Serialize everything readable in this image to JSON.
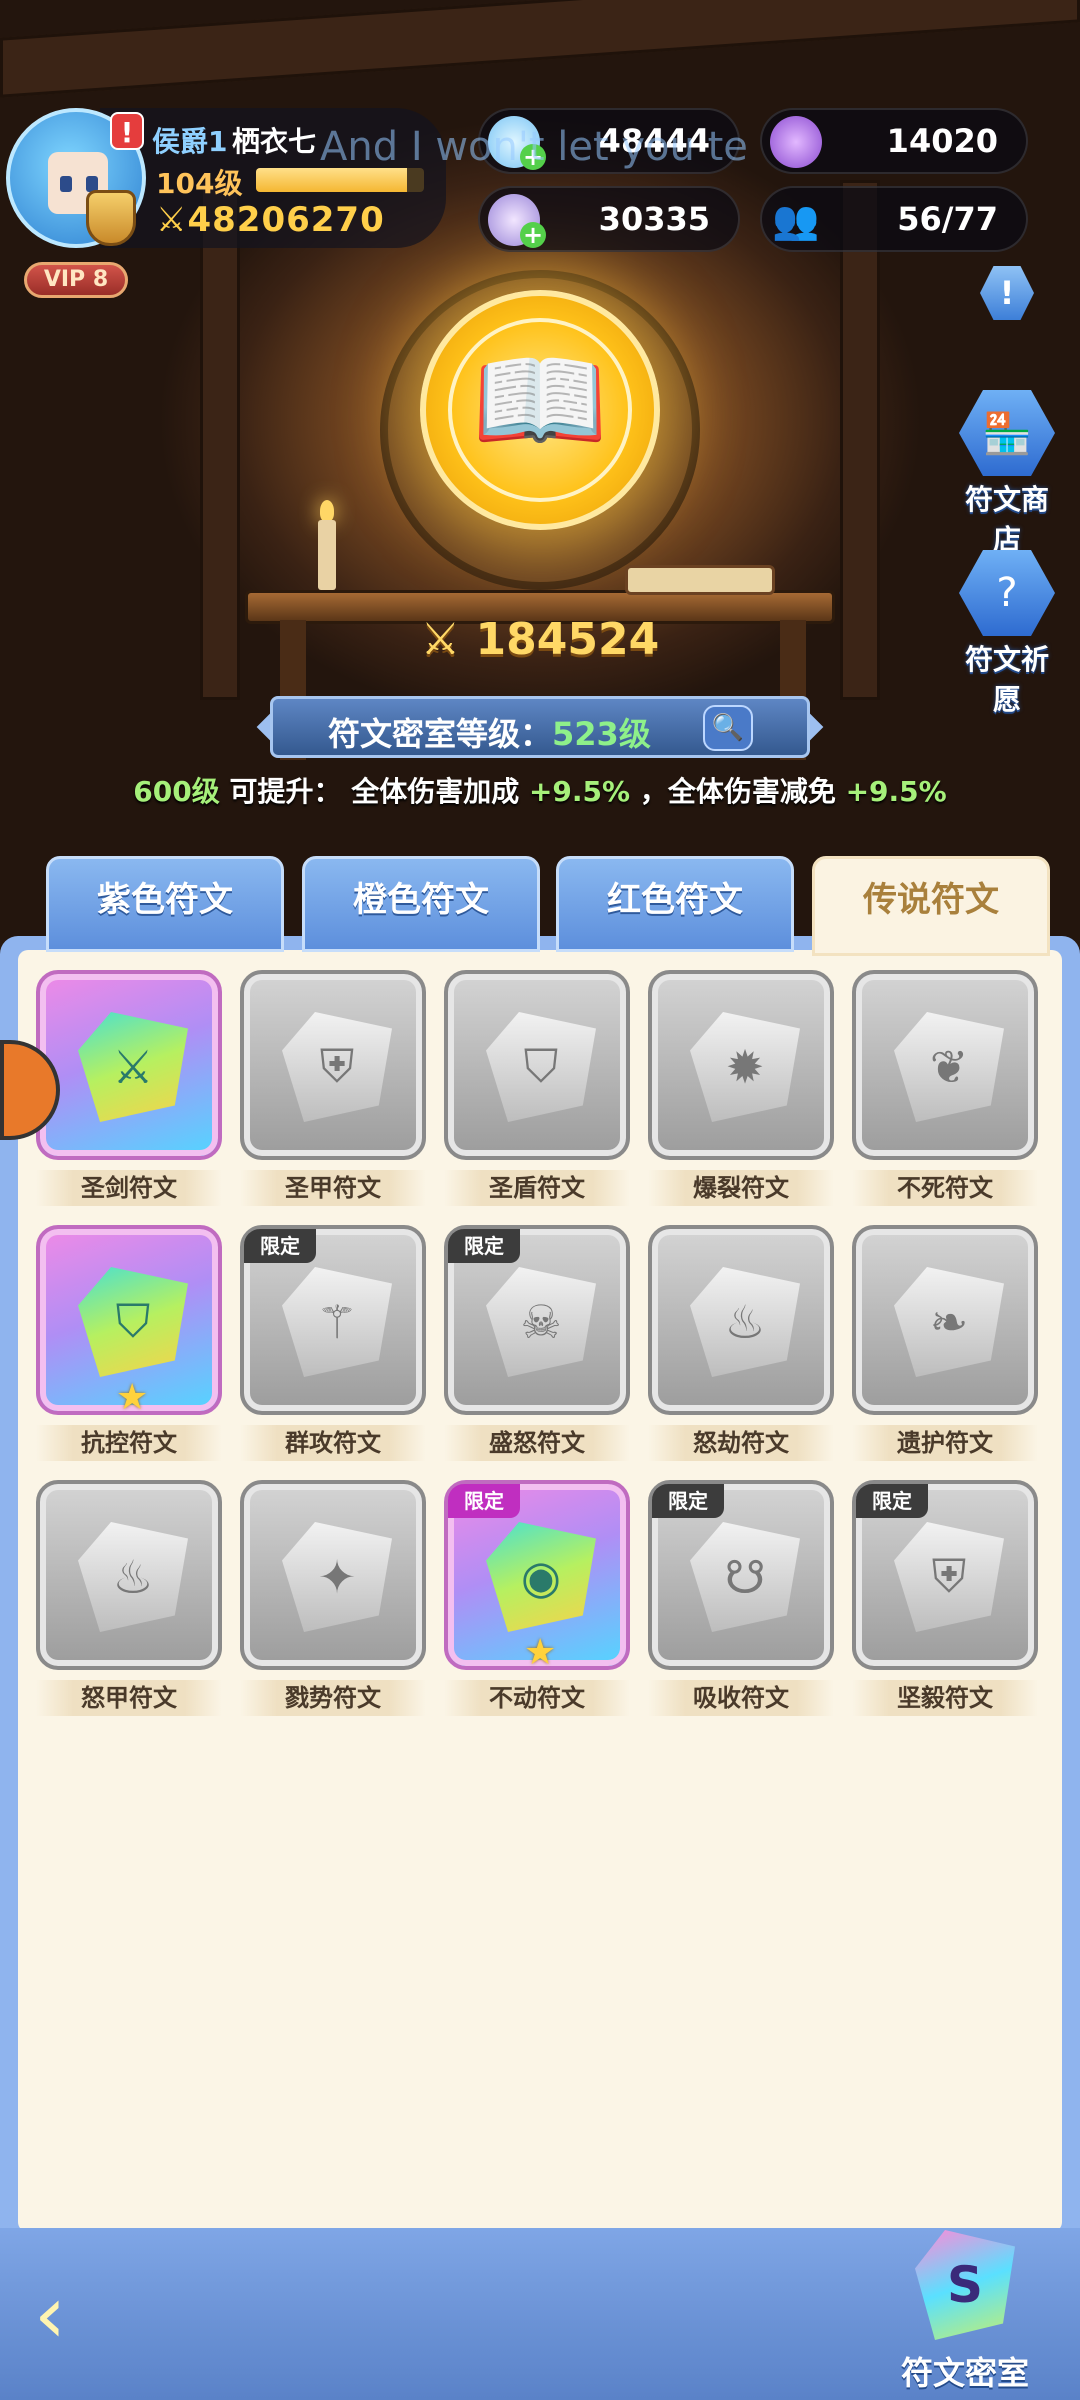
{
  "player": {
    "rank": "侯爵1",
    "name": "栖衣七",
    "level": "104级",
    "xp_fraction": 0.9,
    "power": "48206270",
    "vip": "VIP 8",
    "alert_icon": "exclamation-icon"
  },
  "resources": {
    "crystal": "48444",
    "gem": "30335",
    "purple_coin": "14020",
    "friends": "56/77"
  },
  "overlay_lyric": "And I won't let you te",
  "side_buttons": {
    "shop": "符文商店",
    "wish": "符文祈愿",
    "info_icon": "!"
  },
  "chamber": {
    "power": "184524",
    "level_label": "符文密室等级：",
    "level_value": "523级",
    "upgrade_level": "600级",
    "upgrade_text": " 可提升： 全体伤害加成 ",
    "bonus1": "+9.5%",
    "upgrade_sep": " ，全体伤害减免 ",
    "bonus2": "+9.5%"
  },
  "tabs": [
    "紫色符文",
    "橙色符文",
    "红色符文",
    "传说符文"
  ],
  "active_tab": "传说符文",
  "runes": [
    {
      "label": "圣剑符文",
      "owned": true,
      "limited": false,
      "star": false,
      "icon": "⚔"
    },
    {
      "label": "圣甲符文",
      "owned": false,
      "limited": false,
      "star": false,
      "icon": "⛨"
    },
    {
      "label": "圣盾符文",
      "owned": false,
      "limited": false,
      "star": false,
      "icon": "⛉"
    },
    {
      "label": "爆裂符文",
      "owned": false,
      "limited": false,
      "star": false,
      "icon": "✹"
    },
    {
      "label": "不死符文",
      "owned": false,
      "limited": false,
      "star": false,
      "icon": "❦"
    },
    {
      "label": "抗控符文",
      "owned": true,
      "limited": false,
      "star": true,
      "icon": "⛉"
    },
    {
      "label": "群攻符文",
      "owned": false,
      "limited": true,
      "star": false,
      "icon": "⚚"
    },
    {
      "label": "盛怒符文",
      "owned": false,
      "limited": true,
      "star": false,
      "icon": "☠"
    },
    {
      "label": "怒劫符文",
      "owned": false,
      "limited": false,
      "star": false,
      "icon": "♨"
    },
    {
      "label": "遗护符文",
      "owned": false,
      "limited": false,
      "star": false,
      "icon": "❧"
    },
    {
      "label": "怒甲符文",
      "owned": false,
      "limited": false,
      "star": false,
      "icon": "♨"
    },
    {
      "label": "戮势符文",
      "owned": false,
      "limited": false,
      "star": false,
      "icon": "✦"
    },
    {
      "label": "不动符文",
      "owned": true,
      "limited": true,
      "star": true,
      "icon": "◉"
    },
    {
      "label": "吸收符文",
      "owned": false,
      "limited": true,
      "star": false,
      "icon": "☋"
    },
    {
      "label": "坚毅符文",
      "owned": false,
      "limited": true,
      "star": false,
      "icon": "⛨"
    }
  ],
  "limited_label": "限定",
  "bottom": {
    "chamber_label": "符文密室",
    "chamber_icon_glyph": "S",
    "back_icon": "back-arrow-icon"
  }
}
